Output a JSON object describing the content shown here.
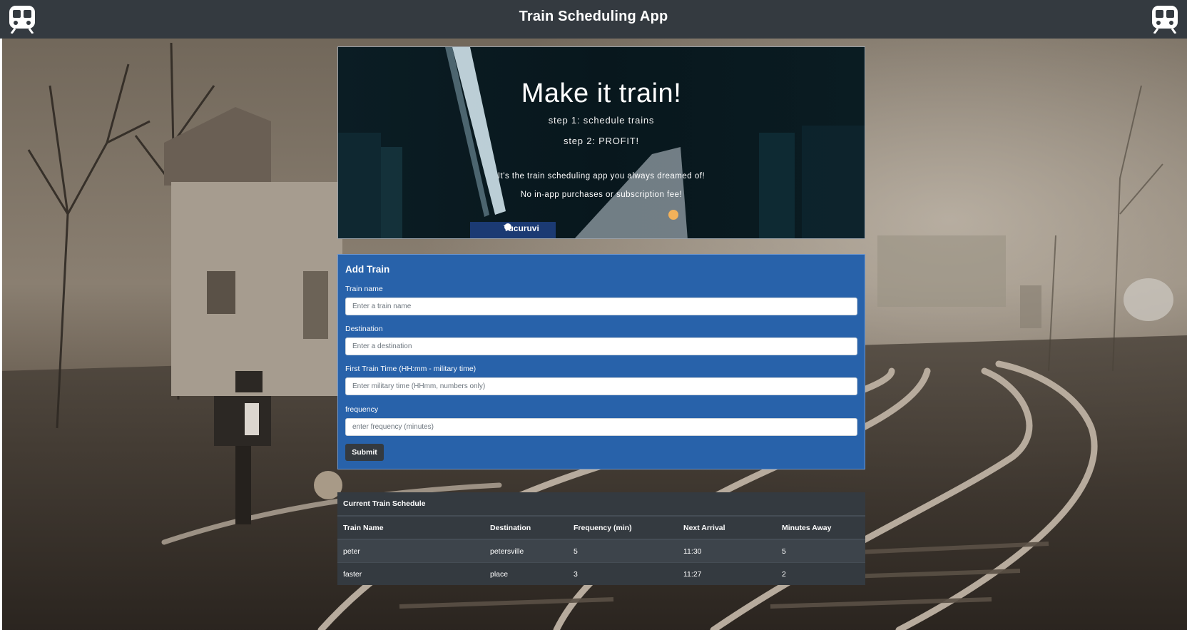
{
  "navbar": {
    "title": "Train Scheduling App",
    "left_icon": "train-icon",
    "right_icon": "train-icon"
  },
  "hero": {
    "heading": "Make it train!",
    "step1": "step 1: schedule trains",
    "step2": "step 2: PROFIT!",
    "lead1": "It's the train scheduling app you always dreamed of!",
    "lead2": "No in-app purchases or subscription fee!",
    "station_sign": "Tucuruvi"
  },
  "form": {
    "title": "Add Train",
    "train_name_label": "Train name",
    "train_name_placeholder": "Enter a train name",
    "destination_label": "Destination",
    "destination_placeholder": "Enter a destination",
    "first_time_label": "First Train Time (HH:mm - military time)",
    "first_time_placeholder": "Enter military time (HHmm, numbers only)",
    "frequency_label": "frequency",
    "frequency_placeholder": "enter frequency (minutes)",
    "submit_label": "Submit"
  },
  "schedule": {
    "title": "Current Train Schedule",
    "columns": [
      "Train Name",
      "Destination",
      "Frequency (min)",
      "Next Arrival",
      "Minutes Away"
    ],
    "rows": [
      [
        "peter",
        "petersville",
        "5",
        "11:30",
        "5"
      ],
      [
        "faster",
        "place",
        "3",
        "11:27",
        "2"
      ]
    ]
  },
  "colors": {
    "navbar": "#343a40",
    "card": "#2862aa",
    "table": "#343a40"
  }
}
